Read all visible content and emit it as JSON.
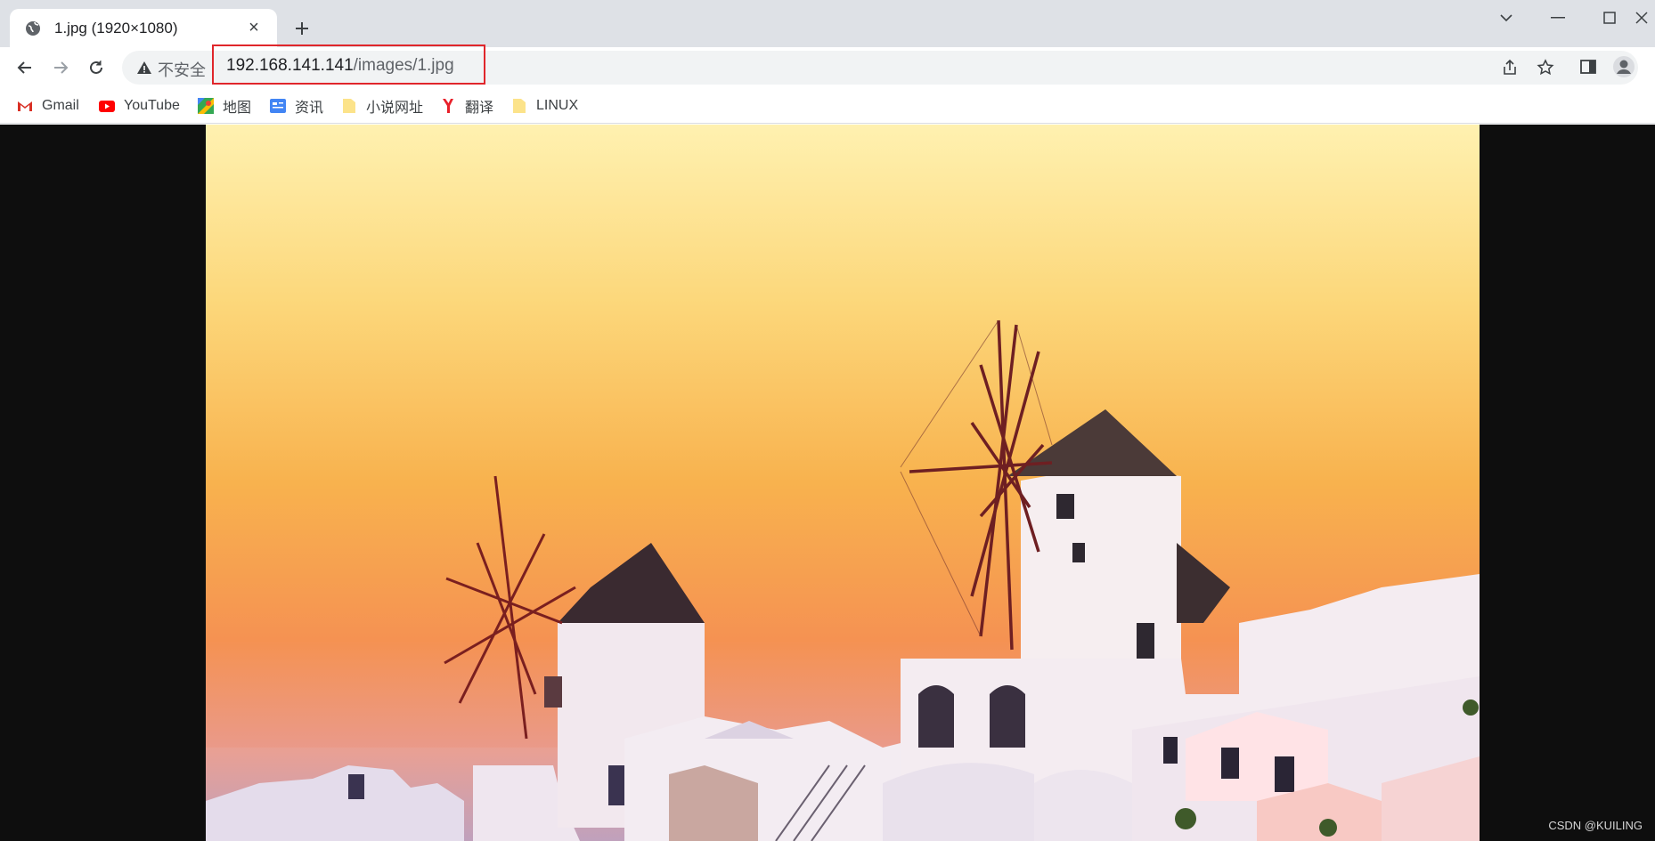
{
  "tab": {
    "title": "1.jpg (1920×1080)",
    "close_glyph": "×",
    "favicon": "globe-icon"
  },
  "new_tab_glyph": "+",
  "window_controls": [
    "chevron-down-icon",
    "minimize-icon",
    "maximize-icon",
    "close-icon"
  ],
  "nav": {
    "back": "arrow-left-icon",
    "forward": "arrow-right-icon",
    "reload": "reload-icon"
  },
  "address": {
    "security_label": "不安全",
    "host": "192.168.141.141",
    "path": "/images/1.jpg"
  },
  "bookmarks": [
    {
      "label": "Gmail",
      "icon": "gmail-icon"
    },
    {
      "label": "YouTube",
      "icon": "youtube-icon"
    },
    {
      "label": "地图",
      "icon": "maps-icon"
    },
    {
      "label": "资讯",
      "icon": "news-icon"
    },
    {
      "label": "小说网址",
      "icon": "folder-icon"
    },
    {
      "label": "翻译",
      "icon": "translate-icon"
    },
    {
      "label": "LINUX",
      "icon": "folder-icon"
    }
  ],
  "watermark": "CSDN @KUILING",
  "colors": {
    "highlight": "#e0262b",
    "tabstrip": "#dee1e6",
    "viewer_bg": "#0e0e0e"
  }
}
